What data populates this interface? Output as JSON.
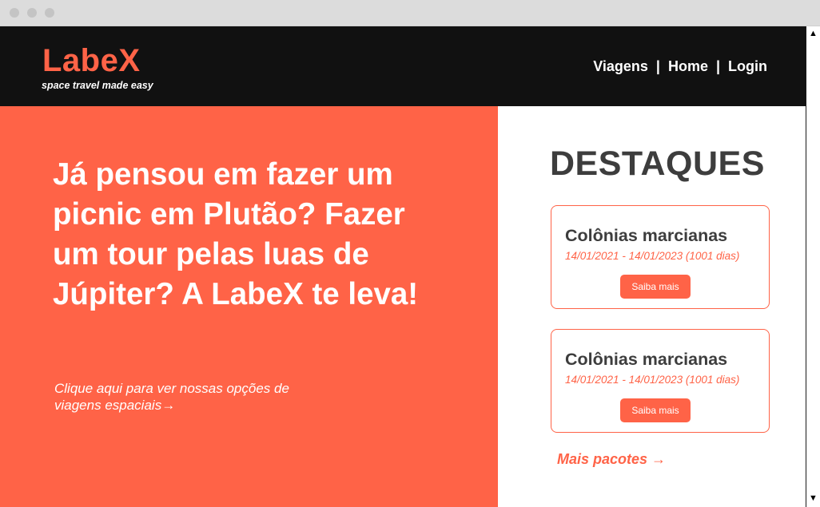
{
  "browser": {
    "window_controls": [
      "close",
      "minimize",
      "maximize"
    ]
  },
  "header": {
    "logo": "LabeX",
    "tagline": "space travel made easy",
    "nav": [
      {
        "label": "Viagens"
      },
      {
        "label": "Home"
      },
      {
        "label": "Login"
      }
    ],
    "separator": "|"
  },
  "hero": {
    "title": "Já pensou em fazer um picnic em Plutão? Fazer um tour pelas luas de Júpiter? A LabeX te leva!",
    "cta": "Clique aqui para ver nossas opções de viagens espaciais→"
  },
  "highlights": {
    "title": "DESTAQUES",
    "cards": [
      {
        "title": "Colônias marcianas",
        "dates": "14/01/2021 - 14/01/2023 (1001 dias)",
        "button": "Saiba mais"
      },
      {
        "title": "Colônias marcianas",
        "dates": "14/01/2021 - 14/01/2023 (1001 dias)",
        "button": "Saiba mais"
      }
    ],
    "more_link": "Mais pacotes →"
  },
  "scrollbar": {
    "up_arrow": "▲",
    "down_arrow": "▼"
  },
  "colors": {
    "accent": "#ff6347",
    "header_bg": "#111111",
    "heading_text": "#3d3d3d",
    "white": "#ffffff"
  }
}
